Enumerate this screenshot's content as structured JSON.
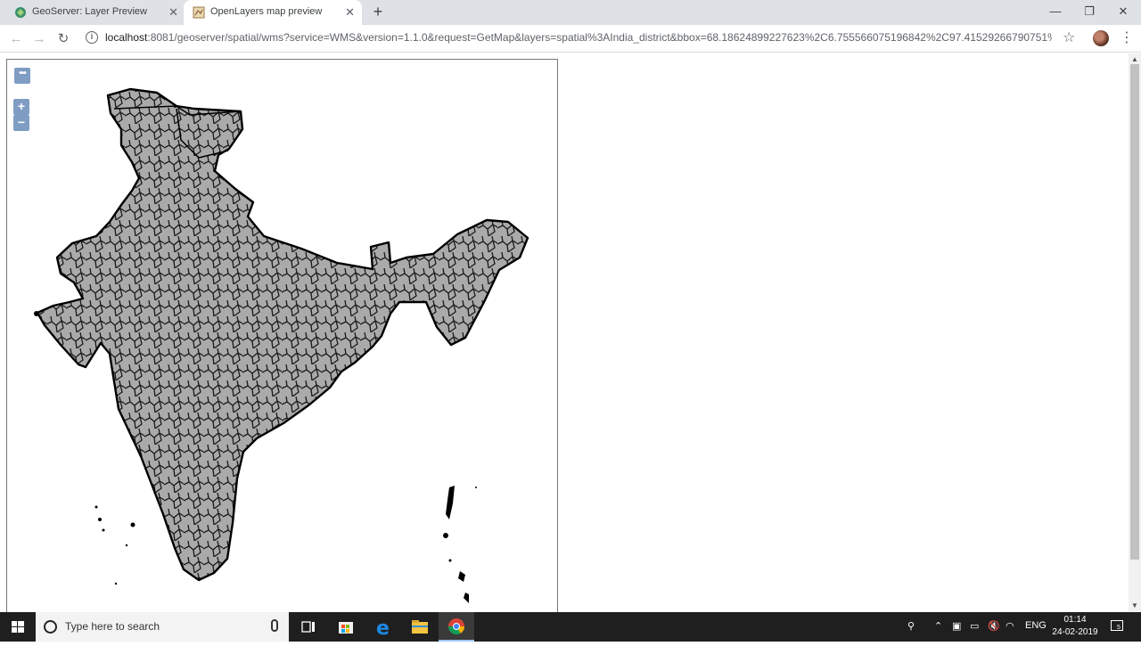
{
  "tabs": [
    {
      "title": "GeoServer: Layer Preview",
      "close": "✕"
    },
    {
      "title": "OpenLayers map preview",
      "close": "✕"
    }
  ],
  "new_tab": "+",
  "window_controls": {
    "minimize": "—",
    "maximize": "❐",
    "close": "✕"
  },
  "toolbar": {
    "back": "←",
    "forward": "→",
    "reload": "↻",
    "url_host": "localhost",
    "url_rest": ":8081/geoserver/spatial/wms?service=WMS&version=1.1.0&request=GetMap&layers=spatial%3AIndia_district&bbox=68.18624899227623%2C6.755566075196842%2C97.41529266790751%2C37....",
    "bookmark_icon": "star-icon",
    "menu": "⋮"
  },
  "map": {
    "layer": "spatial:India_district",
    "controls": {
      "more": "•••",
      "zoom_in": "+",
      "zoom_out": "−"
    },
    "fill_color": "#aaaaaa",
    "stroke_color": "#000000"
  },
  "taskbar": {
    "search_placeholder": "Type here to search",
    "language": "ENG",
    "time": "01:14",
    "date": "24-02-2019",
    "notifications": "5"
  }
}
